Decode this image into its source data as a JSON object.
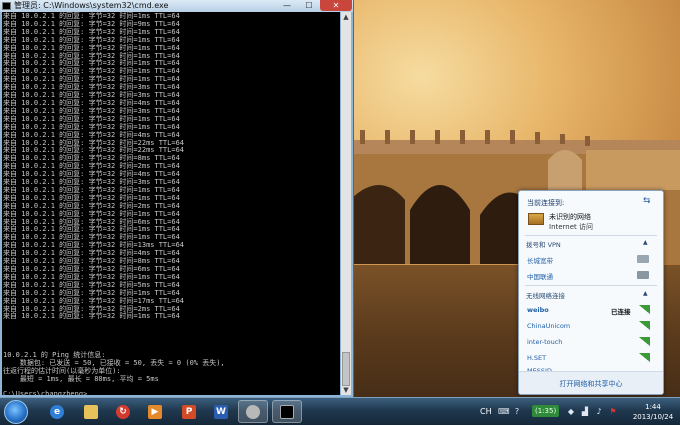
{
  "window": {
    "title": "管理员: C:\\Windows\\system32\\cmd.exe",
    "btn_min": "—",
    "btn_max": "☐",
    "btn_close": "✕"
  },
  "console": {
    "ping_lines": [
      "来自 10.0.2.1 的回复: 字节=32 时间=1ms TTL=64",
      "来自 10.0.2.1 的回复: 字节=32 时间=9ms TTL=64",
      "来自 10.0.2.1 的回复: 字节=32 时间=1ms TTL=64",
      "来自 10.0.2.1 的回复: 字节=32 时间=1ms TTL=64",
      "来自 10.0.2.1 的回复: 字节=32 时间=1ms TTL=64",
      "来自 10.0.2.1 的回复: 字节=32 时间=1ms TTL=64",
      "来自 10.0.2.1 的回复: 字节=32 时间=1ms TTL=64",
      "来自 10.0.2.1 的回复: 字节=32 时间=1ms TTL=64",
      "来自 10.0.2.1 的回复: 字节=32 时间=1ms TTL=64",
      "来自 10.0.2.1 的回复: 字节=32 时间=3ms TTL=64",
      "来自 10.0.2.1 的回复: 字节=32 时间=3ms TTL=64",
      "来自 10.0.2.1 的回复: 字节=32 时间=4ms TTL=64",
      "来自 10.0.2.1 的回复: 字节=32 时间=3ms TTL=64",
      "来自 10.0.2.1 的回复: 字节=32 时间=1ms TTL=64",
      "来自 10.0.2.1 的回复: 字节=32 时间=1ms TTL=64",
      "来自 10.0.2.1 的回复: 字节=32 时间=4ms TTL=64",
      "来自 10.0.2.1 的回复: 字节=32 时间=22ms TTL=64",
      "来自 10.0.2.1 的回复: 字节=32 时间=22ms TTL=64",
      "来自 10.0.2.1 的回复: 字节=32 时间=8ms TTL=64",
      "来自 10.0.2.1 的回复: 字节=32 时间=2ms TTL=64",
      "来自 10.0.2.1 的回复: 字节=32 时间=4ms TTL=64",
      "来自 10.0.2.1 的回复: 字节=32 时间=3ms TTL=64",
      "来自 10.0.2.1 的回复: 字节=32 时间=1ms TTL=64",
      "来自 10.0.2.1 的回复: 字节=32 时间=1ms TTL=64",
      "来自 10.0.2.1 的回复: 字节=32 时间=2ms TTL=64",
      "来自 10.0.2.1 的回复: 字节=32 时间=1ms TTL=64",
      "来自 10.0.2.1 的回复: 字节=32 时间=6ms TTL=64",
      "来自 10.0.2.1 的回复: 字节=32 时间=1ms TTL=64",
      "来自 10.0.2.1 的回复: 字节=32 时间=1ms TTL=64",
      "来自 10.0.2.1 的回复: 字节=32 时间=13ms TTL=64",
      "来自 10.0.2.1 的回复: 字节=32 时间=4ms TTL=64",
      "来自 10.0.2.1 的回复: 字节=32 时间=8ms TTL=64",
      "来自 10.0.2.1 的回复: 字节=32 时间=6ms TTL=64",
      "来自 10.0.2.1 的回复: 字节=32 时间=1ms TTL=64",
      "来自 10.0.2.1 的回复: 字节=32 时间=5ms TTL=64",
      "来自 10.0.2.1 的回复: 字节=32 时间=1ms TTL=64",
      "来自 10.0.2.1 的回复: 字节=32 时间=17ms TTL=64",
      "来自 10.0.2.1 的回复: 字节=32 时间=2ms TTL=64",
      "来自 10.0.2.1 的回复: 字节=32 时间=1ms TTL=64"
    ],
    "stats_lines": [
      "",
      "10.0.2.1 的 Ping 统计信息:",
      "    数据包: 已发送 = 50, 已接收 = 50, 丢失 = 0 (0% 丢失),",
      "往返行程的估计时间(以毫秒为单位):",
      "    最短 = 1ms, 最长 = 80ms, 平均 = 5ms",
      "",
      "C:\\Users\\changzheng>"
    ]
  },
  "flyout": {
    "title": "当前连接到:",
    "current_network": "未识别的网络",
    "current_status": "Internet 访问",
    "vpn_section": "拨号和 VPN",
    "vpn_items": [
      "长城宽带",
      "中国联通"
    ],
    "wifi_section": "无线网络连接",
    "wifi_items": [
      "weibo",
      "ChinaUnicom",
      "inter-touch",
      "H.SET",
      "MESSID"
    ],
    "connected_label": "已连接",
    "open_center": "打开网络和共享中心"
  },
  "taskbar": {
    "input_lang": "CH",
    "timer": "(1:35)",
    "clock_time": "1:44",
    "clock_date": "2013/10/24",
    "apps": [
      "internet-explorer",
      "file-explorer",
      "media-app",
      "media-player",
      "powerpoint",
      "word",
      "paint",
      "cmd"
    ]
  }
}
